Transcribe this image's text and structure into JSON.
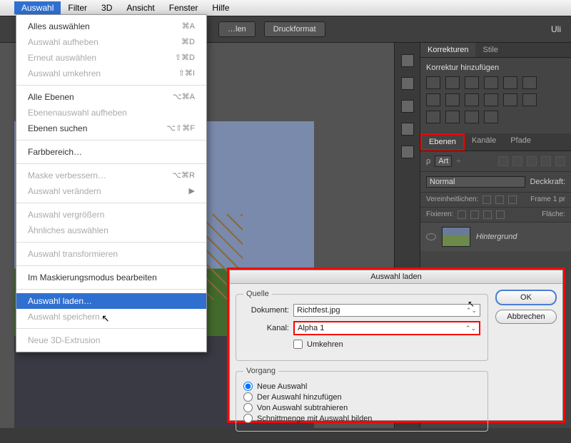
{
  "menubar": {
    "items": [
      "Auswahl",
      "Filter",
      "3D",
      "Ansicht",
      "Fenster",
      "Hilfe"
    ],
    "active_index": 0
  },
  "toolbar": {
    "buttons": [
      "…len",
      "Druckformat"
    ],
    "user": "Uli"
  },
  "dropdown": {
    "groups": [
      [
        {
          "label": "Alles auswählen",
          "shortcut": "⌘A",
          "dim": false
        },
        {
          "label": "Auswahl aufheben",
          "shortcut": "⌘D",
          "dim": true
        },
        {
          "label": "Erneut auswählen",
          "shortcut": "⇧⌘D",
          "dim": true
        },
        {
          "label": "Auswahl umkehren",
          "shortcut": "⇧⌘I",
          "dim": true
        }
      ],
      [
        {
          "label": "Alle Ebenen",
          "shortcut": "⌥⌘A",
          "dim": false
        },
        {
          "label": "Ebenenauswahl aufheben",
          "shortcut": "",
          "dim": true
        },
        {
          "label": "Ebenen suchen",
          "shortcut": "⌥⇧⌘F",
          "dim": false
        }
      ],
      [
        {
          "label": "Farbbereich…",
          "shortcut": "",
          "dim": false
        }
      ],
      [
        {
          "label": "Maske verbessern…",
          "shortcut": "⌥⌘R",
          "dim": true
        },
        {
          "label": "Auswahl verändern",
          "shortcut": "▶",
          "dim": true
        }
      ],
      [
        {
          "label": "Auswahl vergrößern",
          "shortcut": "",
          "dim": true
        },
        {
          "label": "Ähnliches auswählen",
          "shortcut": "",
          "dim": true
        }
      ],
      [
        {
          "label": "Auswahl transformieren",
          "shortcut": "",
          "dim": true
        }
      ],
      [
        {
          "label": "Im Maskierungsmodus bearbeiten",
          "shortcut": "",
          "dim": false
        }
      ],
      [
        {
          "label": "Auswahl laden…",
          "shortcut": "",
          "dim": false,
          "hl": true
        },
        {
          "label": "Auswahl speichern…",
          "shortcut": "",
          "dim": true
        }
      ],
      [
        {
          "label": "Neue 3D-Extrusion",
          "shortcut": "",
          "dim": true
        }
      ]
    ]
  },
  "right": {
    "korrekturen": {
      "tabs": [
        "Korrekturen",
        "Stile"
      ],
      "active": 0,
      "title": "Korrektur hinzufügen"
    },
    "layers": {
      "tabs": [
        "Ebenen",
        "Kanäle",
        "Pfade"
      ],
      "active": 0,
      "kind": "Art",
      "blend": "Normal",
      "opacity_label": "Deckkraft:",
      "unify_label": "Vereinheitlichen:",
      "frame_label": "Frame 1 pr",
      "lock_label": "Fixieren:",
      "fill_label": "Fläche:",
      "layer_name": "Hintergrund"
    }
  },
  "dialog": {
    "title": "Auswahl laden",
    "source_legend": "Quelle",
    "doc_label": "Dokument:",
    "doc_value": "Richtfest.jpg",
    "ch_label": "Kanal:",
    "ch_value": "Alpha 1",
    "invert": "Umkehren",
    "op_legend": "Vorgang",
    "ops": [
      {
        "label": "Neue Auswahl",
        "checked": true
      },
      {
        "label": "Der Auswahl hinzufügen",
        "checked": false
      },
      {
        "label": "Von Auswahl subtrahieren",
        "checked": false
      },
      {
        "label": "Schnittmenge mit Auswahl bilden",
        "checked": false
      }
    ],
    "ok": "OK",
    "cancel": "Abbrechen"
  }
}
